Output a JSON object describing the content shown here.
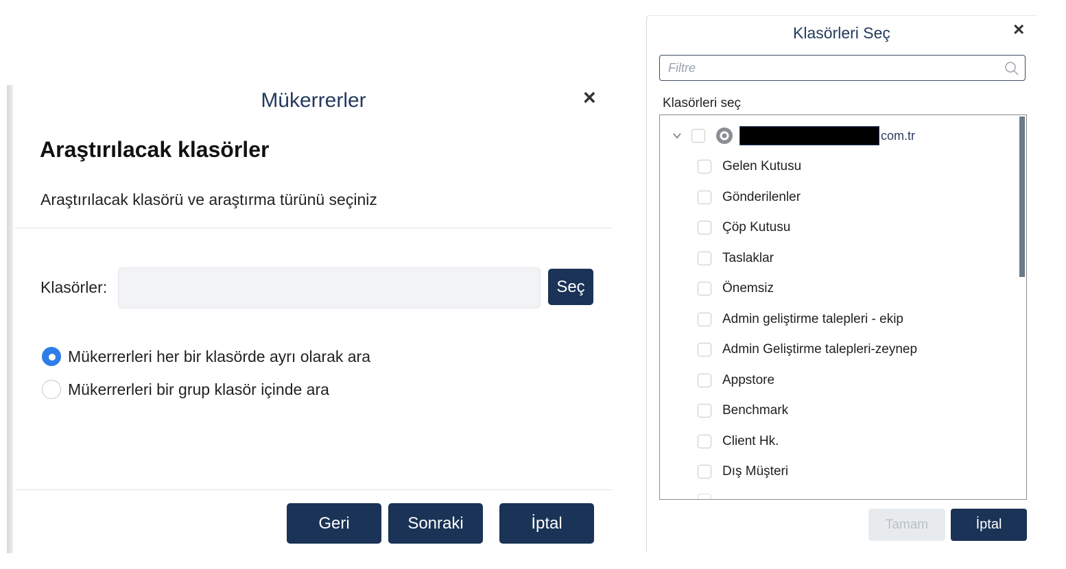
{
  "left_dialog": {
    "title": "Mükerrerler",
    "close_label": "×",
    "heading": "Araştırılacak klasörler",
    "description": "Araştırılacak klasörü ve araştırma türünü seçiniz",
    "folders_label": "Klasörler:",
    "folders_value": "",
    "select_button": "Seç",
    "radio_options": [
      {
        "label": "Mükerrerleri her bir klasörde ayrı olarak ara",
        "checked": true
      },
      {
        "label": "Mükerrerleri bir grup klasör içinde ara",
        "checked": false
      }
    ],
    "buttons": {
      "back": "Geri",
      "next": "Sonraki",
      "cancel": "İptal"
    }
  },
  "right_dialog": {
    "title": "Klasörleri Seç",
    "close_label": "×",
    "filter_placeholder": "Filtre",
    "select_label": "Klasörleri seç",
    "account_suffix": "com.tr",
    "folders": [
      "Gelen Kutusu",
      "Gönderilenler",
      "Çöp Kutusu",
      "Taslaklar",
      "Önemsiz",
      "Admin geliştirme talepleri - ekip",
      "Admin Geliştirme talepleri-zeynep",
      "Appstore",
      "Benchmark",
      "Client Hk.",
      "Dış Müşteri"
    ],
    "buttons": {
      "ok": "Tamam",
      "cancel": "İptal"
    }
  },
  "colors": {
    "primary_button": "#1a3356",
    "radio_checked": "#2f7de8",
    "title_text": "#243a5e",
    "disabled_button_bg": "#e8ebee"
  }
}
